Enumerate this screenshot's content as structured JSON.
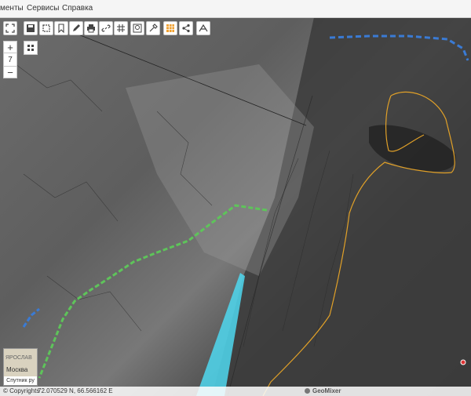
{
  "menu": {
    "items": [
      "менты",
      "Сервисы",
      "Справка"
    ]
  },
  "toolbar": {
    "buttons": [
      {
        "name": "fullscreen-icon"
      },
      {
        "name": "save-icon"
      },
      {
        "name": "frame-icon"
      },
      {
        "name": "bookmark-icon"
      },
      {
        "name": "pencil-icon"
      },
      {
        "name": "print-icon"
      },
      {
        "name": "link-icon"
      },
      {
        "name": "grid-icon"
      },
      {
        "name": "search-area-icon"
      },
      {
        "name": "picker-icon"
      },
      {
        "name": "table-icon"
      },
      {
        "name": "share-icon"
      },
      {
        "name": "measure-icon"
      }
    ]
  },
  "zoom": {
    "plus": "+",
    "level": "7",
    "minus": "−"
  },
  "minimap": {
    "sub": "ЯРОСЛАВ",
    "city": "Москва",
    "layer": "Спутник ру"
  },
  "status": {
    "copyright": "© Copyrights",
    "coords": "72.070529 N, 66.566162 E",
    "brand": "GeoMixer"
  },
  "colors": {
    "track_blue": "#3a7bd5",
    "track_green": "#5ec45a",
    "boundary": "#e0a028",
    "swath": "#4fd8f0"
  }
}
